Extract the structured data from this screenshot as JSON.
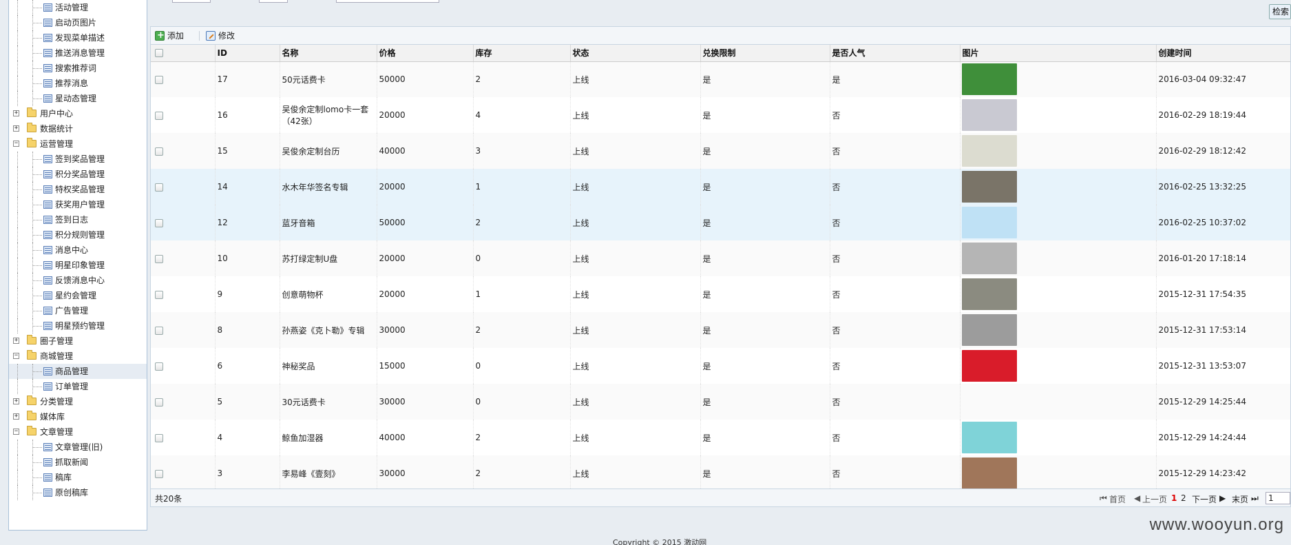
{
  "sidebar": {
    "items": [
      {
        "label": "活动管理",
        "level": 2
      },
      {
        "label": "启动页图片",
        "level": 2
      },
      {
        "label": "发现菜单描述",
        "level": 2
      },
      {
        "label": "推送消息管理",
        "level": 2
      },
      {
        "label": "搜索推荐词",
        "level": 2
      },
      {
        "label": "推荐消息",
        "level": 2
      },
      {
        "label": "星动态管理",
        "level": 2
      },
      {
        "label": "用户中心",
        "level": 1,
        "expander": "+"
      },
      {
        "label": "数据统计",
        "level": 1,
        "expander": "+"
      },
      {
        "label": "运营管理",
        "level": 1,
        "expander": "−"
      },
      {
        "label": "签到奖品管理",
        "level": 2
      },
      {
        "label": "积分奖品管理",
        "level": 2
      },
      {
        "label": "特权奖品管理",
        "level": 2
      },
      {
        "label": "获奖用户管理",
        "level": 2
      },
      {
        "label": "签到日志",
        "level": 2
      },
      {
        "label": "积分规则管理",
        "level": 2
      },
      {
        "label": "消息中心",
        "level": 2
      },
      {
        "label": "明星印象管理",
        "level": 2
      },
      {
        "label": "反馈消息中心",
        "level": 2
      },
      {
        "label": "星约会管理",
        "level": 2
      },
      {
        "label": "广告管理",
        "level": 2
      },
      {
        "label": "明星预约管理",
        "level": 2
      },
      {
        "label": "圈子管理",
        "level": 1,
        "expander": "+"
      },
      {
        "label": "商城管理",
        "level": 1,
        "expander": "−"
      },
      {
        "label": "商品管理",
        "level": 2,
        "selected": true
      },
      {
        "label": "订单管理",
        "level": 2
      },
      {
        "label": "分类管理",
        "level": 1,
        "expander": "+"
      },
      {
        "label": "媒体库",
        "level": 1,
        "expander": "+"
      },
      {
        "label": "文章管理",
        "level": 1,
        "expander": "−"
      },
      {
        "label": "文章管理(旧)",
        "level": 2
      },
      {
        "label": "抓取新闻",
        "level": 2
      },
      {
        "label": "稿库",
        "level": 2
      },
      {
        "label": "原创稿库",
        "level": 2
      }
    ]
  },
  "search": {
    "button_label": "检索"
  },
  "toolbar": {
    "add_label": "添加",
    "edit_label": "修改"
  },
  "table": {
    "columns": [
      "ID",
      "名称",
      "价格",
      "库存",
      "状态",
      "兑换限制",
      "是否人气",
      "图片",
      "创建时间"
    ],
    "rows": [
      {
        "id": "17",
        "name": "50元话费卡",
        "price": "50000",
        "stock": "2",
        "status": "上线",
        "limit": "是",
        "popular": "是",
        "created": "2016-03-04 09:32:47",
        "thumb_color": "#3f8f3a",
        "style": "alt"
      },
      {
        "id": "16",
        "name": "吴俊余定制lomo卡一套（42张）",
        "price": "20000",
        "stock": "4",
        "status": "上线",
        "limit": "是",
        "popular": "否",
        "created": "2016-02-29 18:19:44",
        "thumb_color": "#c9c9d2",
        "style": ""
      },
      {
        "id": "15",
        "name": "吴俊余定制台历",
        "price": "40000",
        "stock": "3",
        "status": "上线",
        "limit": "是",
        "popular": "否",
        "created": "2016-02-29 18:12:42",
        "thumb_color": "#dcdcd0",
        "style": "alt"
      },
      {
        "id": "14",
        "name": "水木年华签名专辑",
        "price": "20000",
        "stock": "1",
        "status": "上线",
        "limit": "是",
        "popular": "否",
        "created": "2016-02-25 13:32:25",
        "thumb_color": "#7a7468",
        "style": "hl"
      },
      {
        "id": "12",
        "name": "蓝牙音箱",
        "price": "50000",
        "stock": "2",
        "status": "上线",
        "limit": "是",
        "popular": "否",
        "created": "2016-02-25 10:37:02",
        "thumb_color": "#bfe1f5",
        "style": "hl"
      },
      {
        "id": "10",
        "name": "苏打绿定制U盘",
        "price": "20000",
        "stock": "0",
        "status": "上线",
        "limit": "是",
        "popular": "否",
        "created": "2016-01-20 17:18:14",
        "thumb_color": "#b5b5b5",
        "style": "alt"
      },
      {
        "id": "9",
        "name": "创意萌物杯",
        "price": "20000",
        "stock": "1",
        "status": "上线",
        "limit": "是",
        "popular": "否",
        "created": "2015-12-31 17:54:35",
        "thumb_color": "#8b8b80",
        "style": ""
      },
      {
        "id": "8",
        "name": "孙燕姿《克卜勒》专辑",
        "price": "30000",
        "stock": "2",
        "status": "上线",
        "limit": "是",
        "popular": "否",
        "created": "2015-12-31 17:53:14",
        "thumb_color": "#9c9c9c",
        "style": "alt"
      },
      {
        "id": "6",
        "name": "神秘奖品",
        "price": "15000",
        "stock": "0",
        "status": "上线",
        "limit": "是",
        "popular": "否",
        "created": "2015-12-31 13:53:07",
        "thumb_color": "#d91c2a",
        "style": ""
      },
      {
        "id": "5",
        "name": "30元话费卡",
        "price": "30000",
        "stock": "0",
        "status": "上线",
        "limit": "是",
        "popular": "否",
        "created": "2015-12-29 14:25:44",
        "thumb_color": "",
        "style": "alt"
      },
      {
        "id": "4",
        "name": "鲸鱼加湿器",
        "price": "40000",
        "stock": "2",
        "status": "上线",
        "limit": "是",
        "popular": "否",
        "created": "2015-12-29 14:24:44",
        "thumb_color": "#7fd3d8",
        "style": ""
      },
      {
        "id": "3",
        "name": "李易峰《壹刻》",
        "price": "30000",
        "stock": "2",
        "status": "上线",
        "limit": "是",
        "popular": "否",
        "created": "2015-12-29 14:23:42",
        "thumb_color": "#a0765a",
        "style": "alt"
      }
    ]
  },
  "pager": {
    "total": "共20条",
    "first": "首页",
    "prev": "上一页",
    "page1": "1",
    "page2": "2",
    "next": "下一页",
    "last": "末页",
    "input_value": "1"
  },
  "footer": {
    "copyright": "Copyright © 2015 激动网",
    "watermark": "www.wooyun.org"
  }
}
